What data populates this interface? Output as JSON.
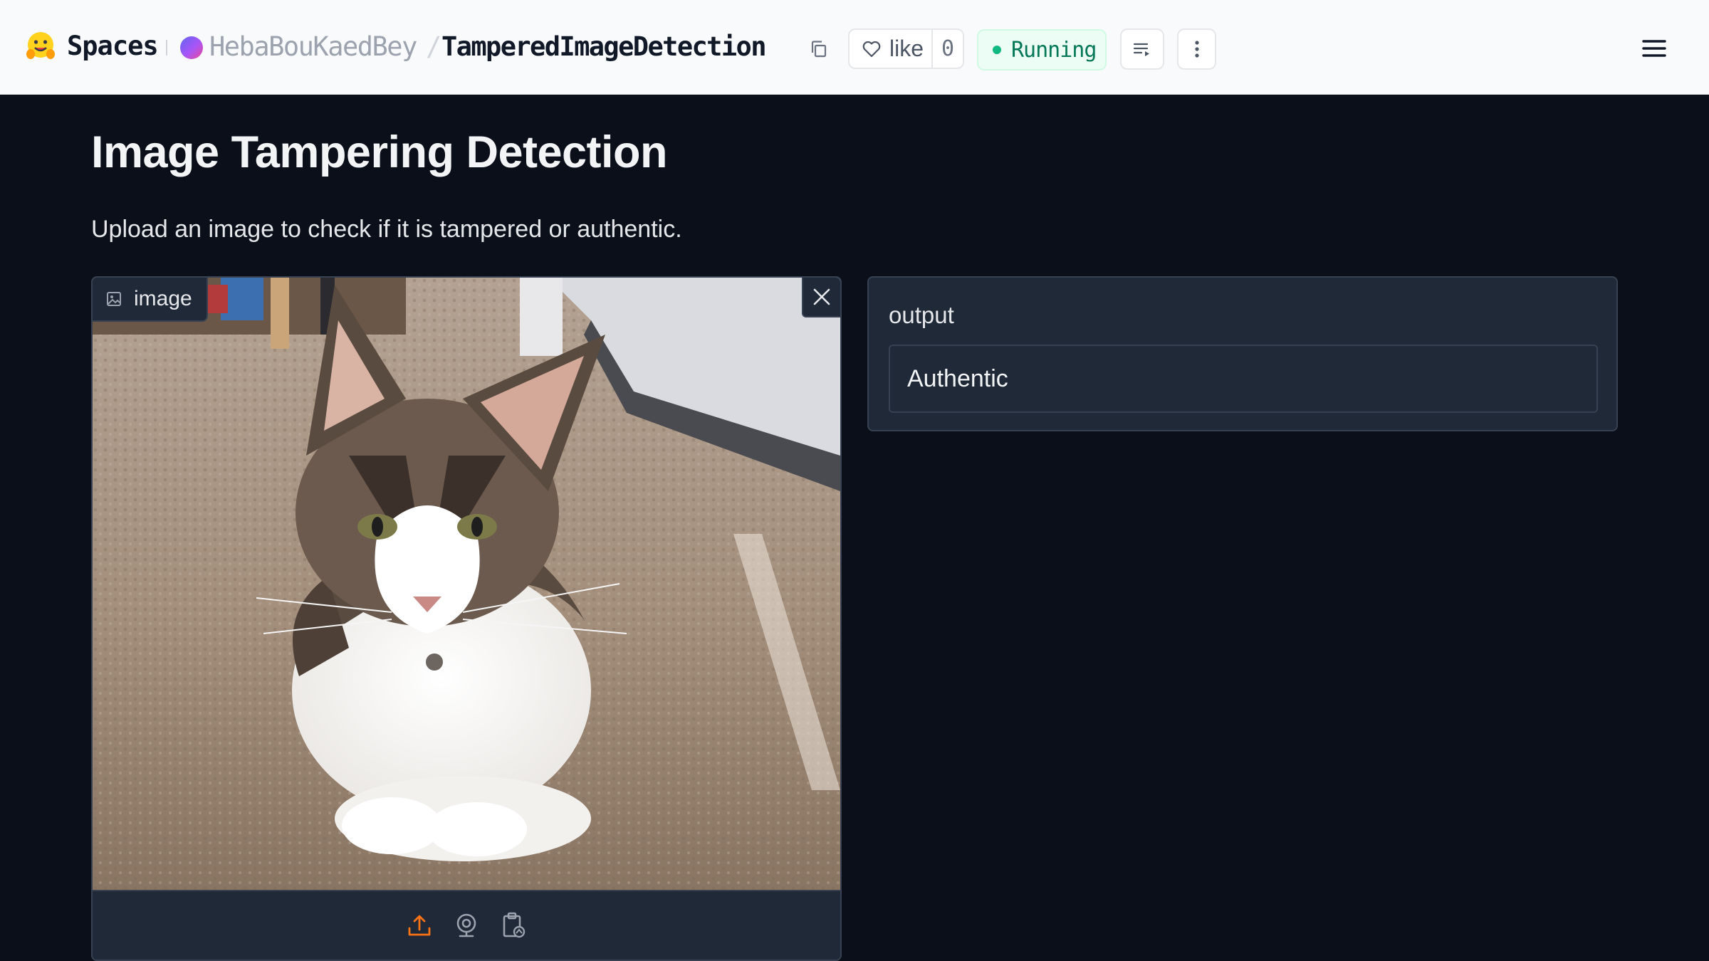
{
  "header": {
    "brand": "Spaces",
    "owner": "HebaBouKaedBey",
    "separator": "/",
    "repo": "TamperedImageDetection",
    "like_label": "like",
    "like_count": "0",
    "status": "Running",
    "icons": {
      "logo": "hugging-face-logo",
      "copy": "copy-icon",
      "like": "heart-icon",
      "logs": "logs-icon",
      "more": "vertical-dots-icon",
      "menu": "hamburger-menu-icon"
    },
    "colors": {
      "status": "#10b981",
      "background": "#f9fafb"
    }
  },
  "app": {
    "title": "Image Tampering Detection",
    "description": "Upload an image to check if it is tampered or authentic.",
    "input": {
      "label": "image",
      "icons": [
        "image-icon",
        "close-icon",
        "upload-icon",
        "webcam-icon",
        "clipboard-icon"
      ],
      "content": "photo of a tabby and white cat lying on carpet"
    },
    "output": {
      "label": "output",
      "value": "Authentic"
    },
    "colors": {
      "background": "#0b0f19",
      "panel": "#1f2937",
      "accent": "#f97316"
    }
  }
}
